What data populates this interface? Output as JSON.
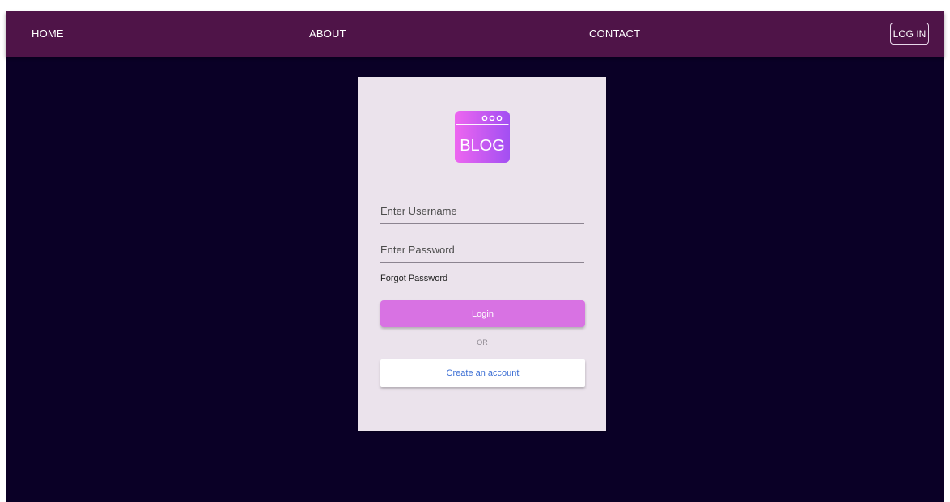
{
  "nav": {
    "home": "HOME",
    "about": "ABOUT",
    "contact": "CONTACT",
    "login": "LOG IN"
  },
  "logo": {
    "text": "BLOG",
    "icon": "browser-window-blog-icon",
    "gradient": [
      "#ee66f0",
      "#a24ff2"
    ]
  },
  "form": {
    "username_placeholder": "Enter Username",
    "password_placeholder": "Enter Password",
    "forgot_password": "Forgot Password",
    "login_button": "Login",
    "or": "OR",
    "create_account": "Create an account"
  },
  "colors": {
    "navbar": "#4f1448",
    "background": "#0a0026",
    "card": "#ebe3ec",
    "login_button": "#d872e3",
    "create_account_text": "#3d6fd4"
  }
}
